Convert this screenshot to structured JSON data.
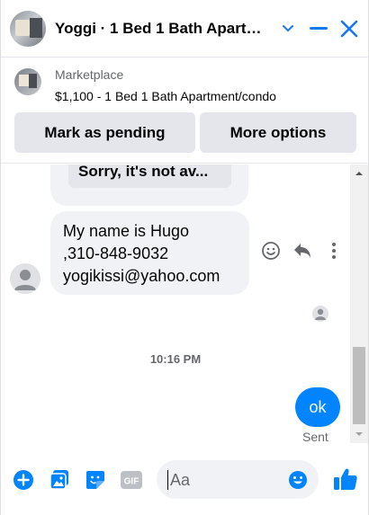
{
  "header": {
    "title": "Yoggi · 1 Bed 1 Bath Apartment/condo",
    "icons": [
      "chevron-down-icon",
      "minimize-icon",
      "close-icon"
    ]
  },
  "marketplace": {
    "label": "Marketplace",
    "item": "$1,100 - 1 Bed 1 Bath Apartment/condo",
    "mark_pending_label": "Mark as pending",
    "more_options_label": "More options"
  },
  "messages": {
    "quoted_text": "Sorry, it's not av...",
    "incoming_lines": [
      "My name is Hugo",
      ",310-848-9032",
      "yogikissi@yahoo.com"
    ],
    "timestamp": "10:16 PM",
    "outgoing_text": "ok",
    "outgoing_status": "Sent"
  },
  "composer": {
    "placeholder": "Aa"
  },
  "colors": {
    "accent": "#0084ff",
    "bubble_gray": "#f0f2f5",
    "button_gray": "#e4e6eb",
    "secondary_text": "#65676b"
  }
}
